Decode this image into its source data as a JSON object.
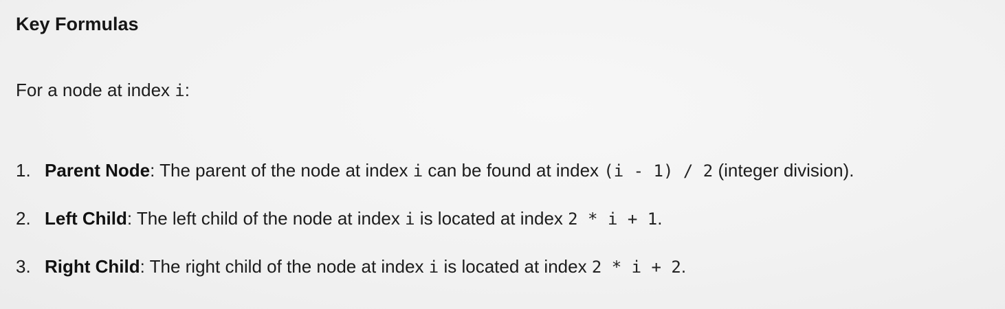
{
  "heading": "Key Formulas",
  "intro": {
    "before": "For a node at index ",
    "code": "i",
    "after": ":"
  },
  "items": [
    {
      "number": "1.",
      "term": "Parent Node",
      "text1": ": The parent of the node at index ",
      "code1": "i",
      "text2": " can be found at index ",
      "code2": "(i - 1) / 2",
      "text3": " (integer division)."
    },
    {
      "number": "2.",
      "term": "Left Child",
      "text1": ": The left child of the node at index ",
      "code1": "i",
      "text2": " is located at index ",
      "code2": "2 * i + 1",
      "text3": "."
    },
    {
      "number": "3.",
      "term": "Right Child",
      "text1": ": The right child of the node at index ",
      "code1": "i",
      "text2": " is located at index ",
      "code2": "2 * i + 2",
      "text3": "."
    }
  ]
}
